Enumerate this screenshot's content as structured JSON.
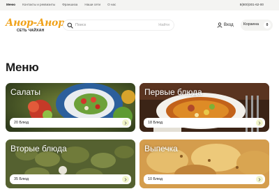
{
  "topbar": {
    "nav": [
      "Меню",
      "Контакты и реквизиты",
      "Франшиза",
      "Наши сети",
      "О нас"
    ],
    "phone": "8(800)301-62-00"
  },
  "header": {
    "logo_text": "Анор-Анор",
    "logo_tagline": "СЕТЬ ЧАЙХАН",
    "search_placeholder": "Поиск",
    "search_button": "Найти",
    "login_label": "Вход",
    "cart_label": "Корзина",
    "cart_count": "0"
  },
  "main": {
    "title": "Меню",
    "categories": [
      {
        "name": "Салаты",
        "count": "20 Блюд"
      },
      {
        "name": "Первые блюда",
        "count": "18 Блюд"
      },
      {
        "name": "Вторые блюда",
        "count": "35 Блюд"
      },
      {
        "name": "Выпечка",
        "count": "10 Блюд"
      }
    ]
  },
  "colors": {
    "logo_orange": "#f0a21a",
    "topbar_bg": "#f4f4f2",
    "arrow_bg": "#f1f4c9",
    "text": "#1b1b1b"
  },
  "icons": [
    "search-icon",
    "user-icon",
    "arrow-right-icon"
  ]
}
